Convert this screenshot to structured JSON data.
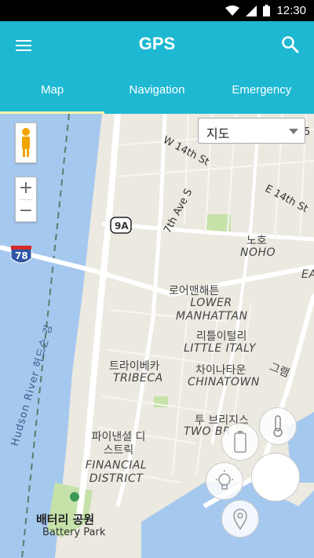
{
  "status_bar": {
    "time": "12:30"
  },
  "app_bar": {
    "title": "GPS"
  },
  "tabs": [
    {
      "label": "Map",
      "active": true
    },
    {
      "label": "Navigation",
      "active": false
    },
    {
      "label": "Emergency",
      "active": false
    }
  ],
  "map": {
    "map_type_selector": "지도",
    "zoom_in": "+",
    "zoom_out": "−",
    "shields": {
      "route_9a": "9A",
      "interstate_78": "78"
    },
    "streets": {
      "w14": "W 14th St",
      "e14": "E 14th St",
      "seventh_ave": "7th Ave S",
      "fifth_ave": "5"
    },
    "neighborhoods": [
      {
        "id": "noho",
        "ko": "노호",
        "en": "NOHO"
      },
      {
        "id": "lower_manhattan",
        "ko": "로어맨해튼",
        "en": "LOWER MANHATTAN"
      },
      {
        "id": "little_italy",
        "ko": "리틀이털리",
        "en": "LITTLE ITALY"
      },
      {
        "id": "tribeca",
        "ko": "트라이베카",
        "en": "TRIBECA"
      },
      {
        "id": "chinatown",
        "ko": "차이나타운",
        "en": "CHINATOWN"
      },
      {
        "id": "two_bridges",
        "ko": "투 브리지스",
        "en": "TWO BR"
      },
      {
        "id": "financial",
        "ko": "파이낸셜 디스트릭",
        "en": "FINANCIAL DISTRICT"
      },
      {
        "id": "battery",
        "ko": "배터리 공원",
        "en": "Battery Park"
      }
    ],
    "river_label": "Hudson River 허드슨 강",
    "edge_labels": {
      "ea": "EA",
      "gram": "그램"
    }
  },
  "colors": {
    "accent": "#1eb8d3",
    "indicator": "#fdf7a6",
    "water": "#a5c8ef",
    "park": "#c6e2a9"
  }
}
